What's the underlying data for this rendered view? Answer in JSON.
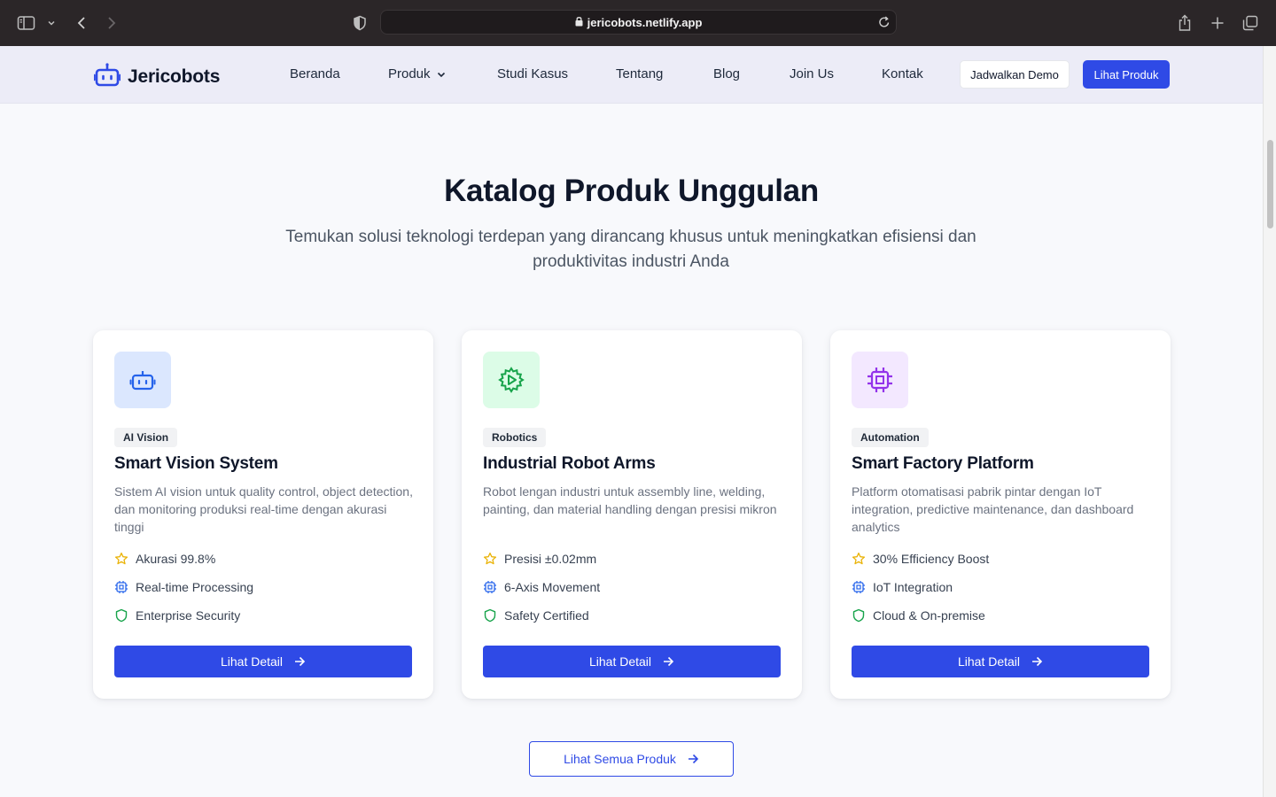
{
  "browser": {
    "url": "jericobots.netlify.app"
  },
  "header": {
    "logo_text": "Jericobots",
    "nav": [
      {
        "label": "Beranda"
      },
      {
        "label": "Produk"
      },
      {
        "label": "Studi Kasus"
      },
      {
        "label": "Tentang"
      },
      {
        "label": "Blog"
      },
      {
        "label": "Join Us"
      },
      {
        "label": "Kontak"
      }
    ],
    "demo_button": "Jadwalkan Demo",
    "products_button": "Lihat Produk"
  },
  "catalog": {
    "title": "Katalog Produk Unggulan",
    "subtitle": "Temukan solusi teknologi terdepan yang dirancang khusus untuk meningkatkan efisiensi dan produktivitas industri Anda",
    "view_all": "Lihat Semua Produk",
    "cards": [
      {
        "icon": "robot-icon",
        "icon_bg": "#dbe7fe",
        "icon_color": "#2563eb",
        "tag": "AI Vision",
        "title": "Smart Vision System",
        "description": "Sistem AI vision untuk quality control, object detection, dan monitoring produksi real-time dengan akurasi tinggi",
        "features": [
          "Akurasi 99.8%",
          "Real-time Processing",
          "Enterprise Security"
        ],
        "button": "Lihat Detail"
      },
      {
        "icon": "cog-play-icon",
        "icon_bg": "#dcfce7",
        "icon_color": "#16a34a",
        "tag": "Robotics",
        "title": "Industrial Robot Arms",
        "description": "Robot lengan industri untuk assembly line, welding, painting, dan material handling dengan presisi mikron",
        "features": [
          "Presisi ±0.02mm",
          "6-Axis Movement",
          "Safety Certified"
        ],
        "button": "Lihat Detail"
      },
      {
        "icon": "cpu-chip-icon",
        "icon_bg": "#f3e8ff",
        "icon_color": "#9333ea",
        "tag": "Automation",
        "title": "Smart Factory Platform",
        "description": "Platform otomatisasi pabrik pintar dengan IoT integration, predictive maintenance, dan dashboard analytics",
        "features": [
          "30% Efficiency Boost",
          "IoT Integration",
          "Cloud & On-premise"
        ],
        "button": "Lihat Detail"
      }
    ]
  },
  "colors": {
    "primary": "#2f4ae6",
    "star": "#eab308",
    "cpu": "#2563eb",
    "shield": "#16a34a"
  }
}
